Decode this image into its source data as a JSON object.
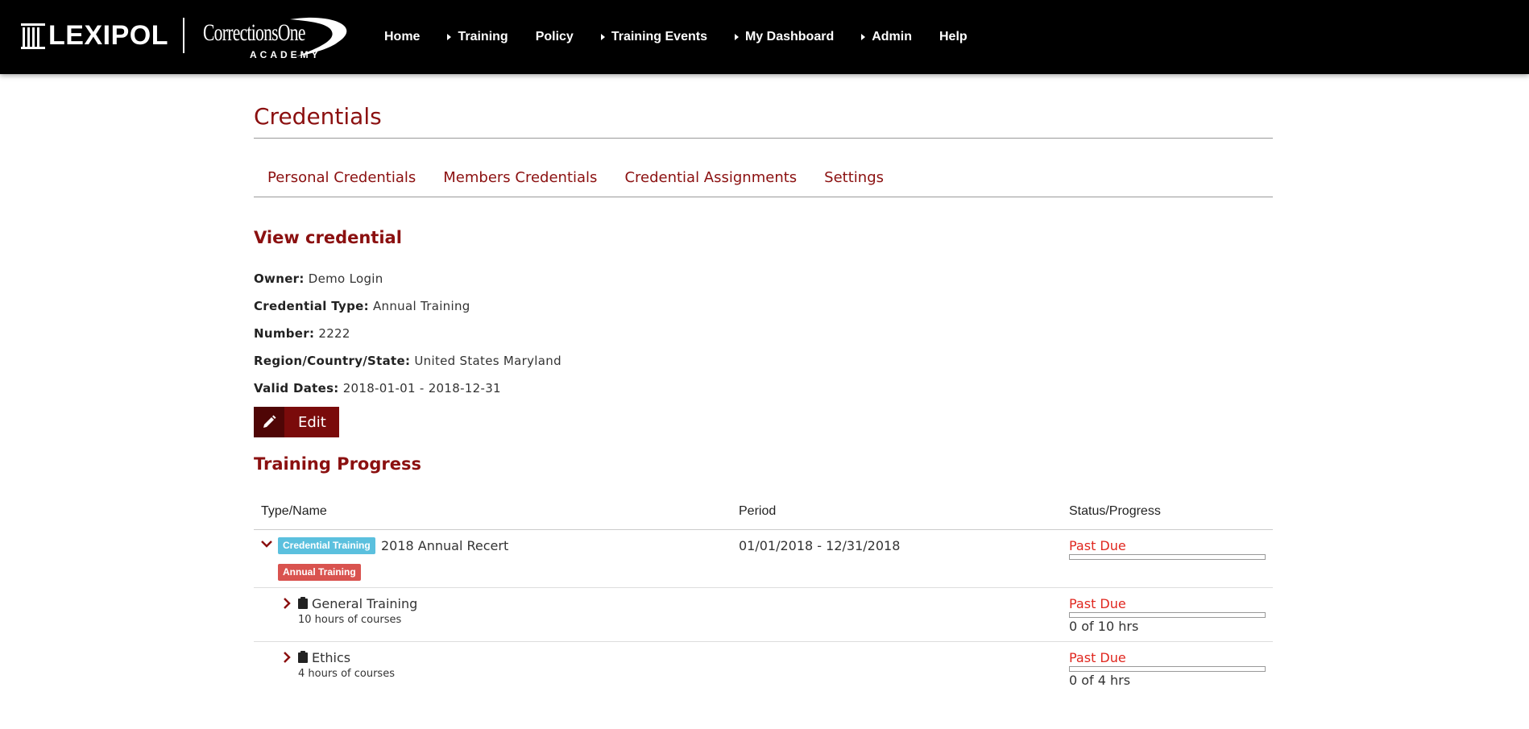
{
  "brand": {
    "lexipol": "LEXIPOL",
    "c1_name": "CorrectionsOne",
    "c1_sub": "ACADEMY"
  },
  "nav": [
    {
      "label": "Home",
      "caret": false
    },
    {
      "label": "Training",
      "caret": true
    },
    {
      "label": "Policy",
      "caret": false
    },
    {
      "label": "Training Events",
      "caret": true
    },
    {
      "label": "My Dashboard",
      "caret": true
    },
    {
      "label": "Admin",
      "caret": true
    },
    {
      "label": "Help",
      "caret": false
    }
  ],
  "page": {
    "title": "Credentials"
  },
  "tabs": [
    "Personal Credentials",
    "Members Credentials",
    "Credential Assignments",
    "Settings"
  ],
  "credential": {
    "heading": "View credential",
    "owner_label": "Owner:",
    "owner": "Demo Login",
    "type_label": "Credential Type:",
    "type": "Annual Training",
    "number_label": "Number:",
    "number": "2222",
    "region_label": "Region/Country/State:",
    "region": "United States Maryland",
    "dates_label": "Valid Dates:",
    "dates": "2018-01-01 - 2018-12-31",
    "edit_label": "Edit"
  },
  "training": {
    "heading": "Training Progress",
    "columns": [
      "Type/Name",
      "Period",
      "Status/Progress"
    ],
    "main_row": {
      "badge_type": "Credential Training",
      "badge_category": "Annual Training",
      "name": "2018 Annual Recert",
      "period": "01/01/2018 - 12/31/2018",
      "status": "Past Due",
      "progress": 0
    },
    "sub_rows": [
      {
        "name": "General Training",
        "detail": "10 hours of courses",
        "status": "Past Due",
        "progress": 0,
        "hours": "0 of 10 hrs"
      },
      {
        "name": "Ethics",
        "detail": "4 hours of courses",
        "status": "Past Due",
        "progress": 0,
        "hours": "0 of 4 hrs"
      }
    ]
  },
  "colors": {
    "brand_red": "#8b1010",
    "badge_blue": "#5bc0de",
    "badge_red": "#d9534f",
    "past_due": "#e0271f"
  }
}
